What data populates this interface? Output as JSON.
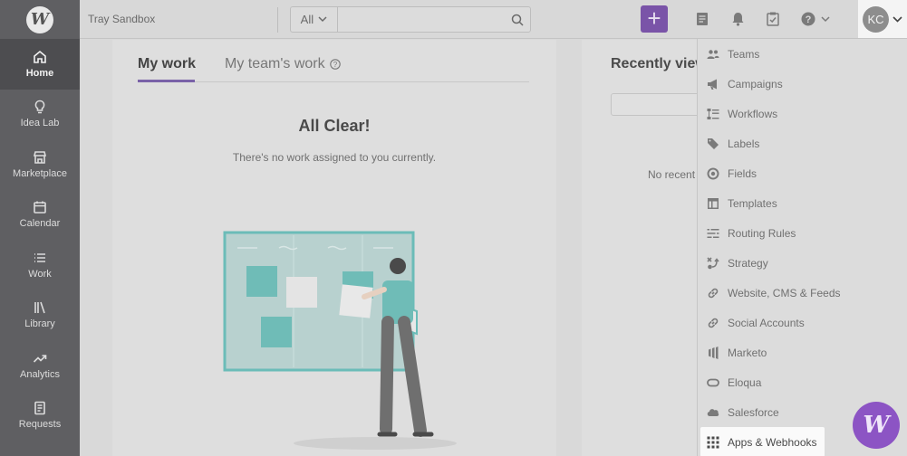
{
  "app": {
    "logo_letter": "W"
  },
  "sidebar": {
    "items": [
      {
        "label": "Home",
        "icon": "home-icon",
        "active": true
      },
      {
        "label": "Idea Lab",
        "icon": "lightbulb-icon"
      },
      {
        "label": "Marketplace",
        "icon": "store-icon"
      },
      {
        "label": "Calendar",
        "icon": "calendar-icon"
      },
      {
        "label": "Work",
        "icon": "list-icon"
      },
      {
        "label": "Library",
        "icon": "library-icon"
      },
      {
        "label": "Analytics",
        "icon": "trend-icon"
      },
      {
        "label": "Requests",
        "icon": "document-icon"
      }
    ]
  },
  "topbar": {
    "workspace": "Tray Sandbox",
    "search_filter": "All",
    "search_placeholder": "",
    "add_label": "+",
    "user_initials": "KC"
  },
  "main": {
    "tabs": [
      {
        "label": "My work",
        "active": true
      },
      {
        "label": "My team's work"
      }
    ],
    "empty_title": "All Clear!",
    "empty_subtitle": "There's no work assigned to you currently."
  },
  "recent": {
    "title": "Recently view",
    "empty_text": "No recent"
  },
  "dropdown": {
    "items": [
      {
        "label": "Teams",
        "icon": "people-icon"
      },
      {
        "label": "Campaigns",
        "icon": "megaphone-icon"
      },
      {
        "label": "Workflows",
        "icon": "workflow-icon"
      },
      {
        "label": "Labels",
        "icon": "tag-icon"
      },
      {
        "label": "Fields",
        "icon": "target-icon"
      },
      {
        "label": "Templates",
        "icon": "template-icon"
      },
      {
        "label": "Routing Rules",
        "icon": "routing-icon"
      },
      {
        "label": "Strategy",
        "icon": "strategy-icon"
      },
      {
        "label": "Website, CMS & Feeds",
        "icon": "link-icon"
      },
      {
        "label": "Social Accounts",
        "icon": "link-icon"
      },
      {
        "label": "Marketo",
        "icon": "marketo-icon"
      },
      {
        "label": "Eloqua",
        "icon": "eloqua-icon"
      },
      {
        "label": "Salesforce",
        "icon": "cloud-icon"
      },
      {
        "label": "Apps & Webhooks",
        "icon": "grid-icon",
        "highlighted": true
      }
    ]
  },
  "colors": {
    "accent": "#7a54a8",
    "fab": "#8c54c4",
    "sidebar": "#5f5f62"
  }
}
